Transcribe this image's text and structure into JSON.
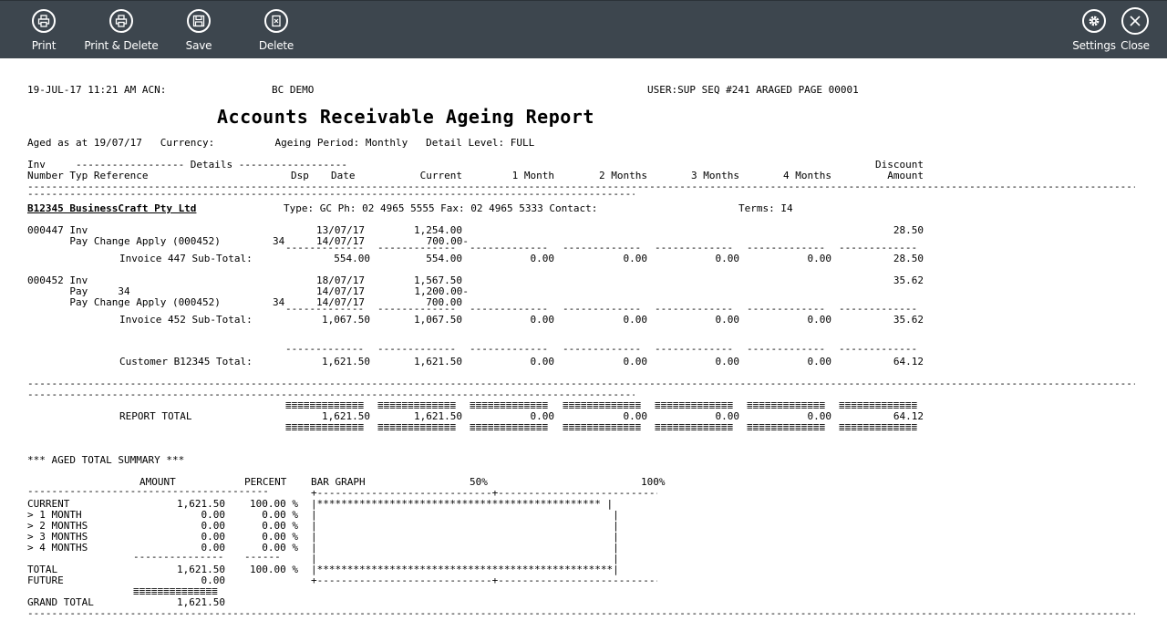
{
  "toolbar": {
    "print": "Print",
    "print_delete": "Print & Delete",
    "save": "Save",
    "delete": "Delete",
    "settings": "Settings",
    "close": "Close"
  },
  "header": {
    "left": "19-JUL-17 11:21 AM ACN:",
    "company": "BC DEMO",
    "right": "USER:SUP SEQ #241 ARAGED PAGE 00001",
    "title": "Accounts Receivable Ageing Report",
    "params": "Aged as at 19/07/17   Currency:          Ageing Period: Monthly   Detail Level: FULL"
  },
  "columns": {
    "row1_left": "Inv     ------------------ Details ------------------",
    "row1_disc": "Discount",
    "row2_left": "Number Typ Reference",
    "dsp": "Dsp",
    "date": "Date",
    "current": "Current",
    "m1": "1 Month",
    "m2": "2 Months",
    "m3": "3 Months",
    "m4": "4 Months",
    "amount": "Amount"
  },
  "rules": {
    "full": "-----------------------------------------------------------------------------------------------------------------------------------------------------------------------------------------------------------------------------------------------",
    "half": "----------------------------------------------------------------------------------------------------------------------------",
    "dash_col": "-------------",
    "eq_col": "=============",
    "sum_dash": "---------------",
    "pct_dash": "------",
    "sum_eq": "==============",
    "bar_top": "+-----------------------------+-----------------------------+",
    "sum_rule": "----------------------------------------"
  },
  "customer": {
    "code": "B12345 BusinessCraft Pty Ltd",
    "info": "Type: GC Ph: 02 4965 5555 Fax: 02 4965 5333 Contact:",
    "terms": "Terms: I4"
  },
  "invoices": [
    {
      "lines": [
        {
          "ref": "000447 Inv",
          "dsp": "",
          "date": "13/07/17",
          "current": "1,254.00",
          "disc": "28.50"
        },
        {
          "ref": "       Pay Change Apply (000452)",
          "dsp": "34",
          "date": "14/07/17",
          "current": "700.00-",
          "disc": ""
        }
      ],
      "subtotal": {
        "label": "Invoice 447 Sub-Total:",
        "amount": "554.00",
        "current": "554.00",
        "m1": "0.00",
        "m2": "0.00",
        "m3": "0.00",
        "m4": "0.00",
        "disc": "28.50"
      }
    },
    {
      "lines": [
        {
          "ref": "000452 Inv",
          "dsp": "",
          "date": "18/07/17",
          "current": "1,567.50",
          "disc": "35.62"
        },
        {
          "ref": "       Pay     34",
          "dsp": "",
          "date": "14/07/17",
          "current": "1,200.00-",
          "disc": ""
        },
        {
          "ref": "       Pay Change Apply (000452)",
          "dsp": "34",
          "date": "14/07/17",
          "current": "700.00",
          "disc": ""
        }
      ],
      "subtotal": {
        "label": "Invoice 452 Sub-Total:",
        "amount": "1,067.50",
        "current": "1,067.50",
        "m1": "0.00",
        "m2": "0.00",
        "m3": "0.00",
        "m4": "0.00",
        "disc": "35.62"
      }
    }
  ],
  "customer_total": {
    "label": "Customer B12345 Total:",
    "amount": "1,621.50",
    "current": "1,621.50",
    "m1": "0.00",
    "m2": "0.00",
    "m3": "0.00",
    "m4": "0.00",
    "disc": "64.12"
  },
  "report_total": {
    "label": "REPORT TOTAL",
    "amount": "1,621.50",
    "current": "1,621.50",
    "m1": "0.00",
    "m2": "0.00",
    "m3": "0.00",
    "m4": "0.00",
    "disc": "64.12"
  },
  "summary": {
    "title": "*** AGED TOTAL SUMMARY ***",
    "h_amount": "AMOUNT",
    "h_percent": "PERCENT",
    "h_bar": "BAR GRAPH",
    "h_50": "50%",
    "h_100": "100%",
    "rows": [
      {
        "label": "CURRENT",
        "amount": "1,621.50",
        "percent": "100.00 %",
        "bar": "|*********************************************** |"
      },
      {
        "label": "> 1 MONTH",
        "amount": "0.00",
        "percent": "0.00 %",
        "bar": "|                                                 |"
      },
      {
        "label": "> 2 MONTHS",
        "amount": "0.00",
        "percent": "0.00 %",
        "bar": "|                                                 |"
      },
      {
        "label": "> 3 MONTHS",
        "amount": "0.00",
        "percent": "0.00 %",
        "bar": "|                                                 |"
      },
      {
        "label": "> 4 MONTHS",
        "amount": "0.00",
        "percent": "0.00 %",
        "bar": "|                                                 |"
      }
    ],
    "blank_bar": "|                                                 |",
    "total": {
      "label": "TOTAL",
      "amount": "1,621.50",
      "percent": "100.00 %",
      "bar": "|*************************************************|"
    },
    "future": {
      "label": "FUTURE",
      "amount": "0.00"
    },
    "grand": {
      "label": "GRAND TOTAL",
      "amount": "1,621.50"
    }
  }
}
